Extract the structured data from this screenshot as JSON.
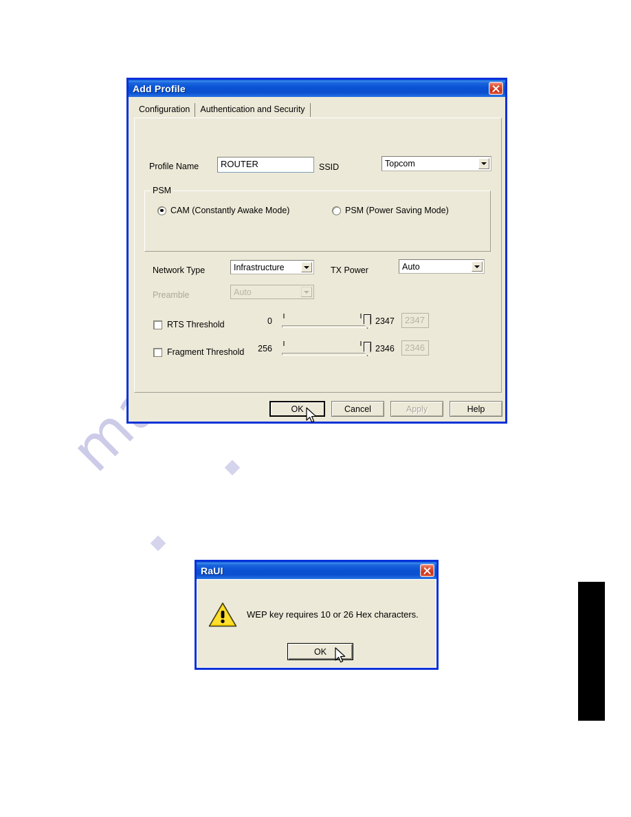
{
  "watermark": {
    "text": "manualshive.com"
  },
  "add_profile_dialog": {
    "title": "Add Profile",
    "close_icon": "close-icon",
    "tabs": [
      {
        "label": "Configuration",
        "active": true
      },
      {
        "label": "Authentication and Security",
        "active": false
      }
    ],
    "profile_name": {
      "label": "Profile Name",
      "value": "ROUTER"
    },
    "ssid": {
      "label": "SSID",
      "value": "Topcom"
    },
    "psm_group": {
      "title": "PSM",
      "options": [
        {
          "label": "CAM (Constantly Awake Mode)",
          "selected": true
        },
        {
          "label": "PSM (Power Saving Mode)",
          "selected": false
        }
      ]
    },
    "network_type": {
      "label": "Network Type",
      "value": "Infrastructure"
    },
    "tx_power": {
      "label": "TX Power",
      "value": "Auto"
    },
    "preamble": {
      "label": "Preamble",
      "value": "Auto",
      "disabled": true
    },
    "rts_threshold": {
      "label": "RTS Threshold",
      "checked": false,
      "min": "0",
      "max": "2347",
      "value": "2347"
    },
    "fragment_threshold": {
      "label": "Fragment Threshold",
      "checked": false,
      "min": "256",
      "max": "2346",
      "value": "2346"
    },
    "buttons": [
      {
        "label": "OK",
        "state": "default"
      },
      {
        "label": "Cancel",
        "state": "normal"
      },
      {
        "label": "Apply",
        "state": "disabled"
      },
      {
        "label": "Help",
        "state": "normal"
      }
    ]
  },
  "raui_dialog": {
    "title": "RaUI",
    "close_icon": "close-icon",
    "warning_icon": "warning-triangle-icon",
    "message": "WEP key requires 10 or 26 Hex characters.",
    "ok_label": "OK"
  }
}
